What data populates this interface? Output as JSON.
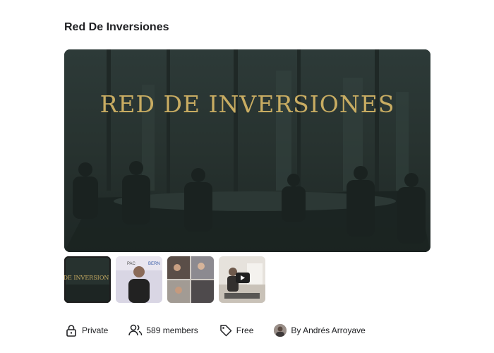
{
  "group": {
    "title": "Red De Inversiones",
    "hero_text": "RED DE INVERSIONES",
    "thumb_caption": "DE INVERSION"
  },
  "thumbnails": [
    {
      "name": "banner",
      "active": true
    },
    {
      "name": "speaker-photo"
    },
    {
      "name": "event-collage"
    },
    {
      "name": "video",
      "has_play": true
    }
  ],
  "meta": {
    "privacy": "Private",
    "members": "589 members",
    "price": "Free",
    "author": "By Andrés Arroyave"
  },
  "colors": {
    "gold": "#c8ac62",
    "hero_bg": "#25302f"
  }
}
